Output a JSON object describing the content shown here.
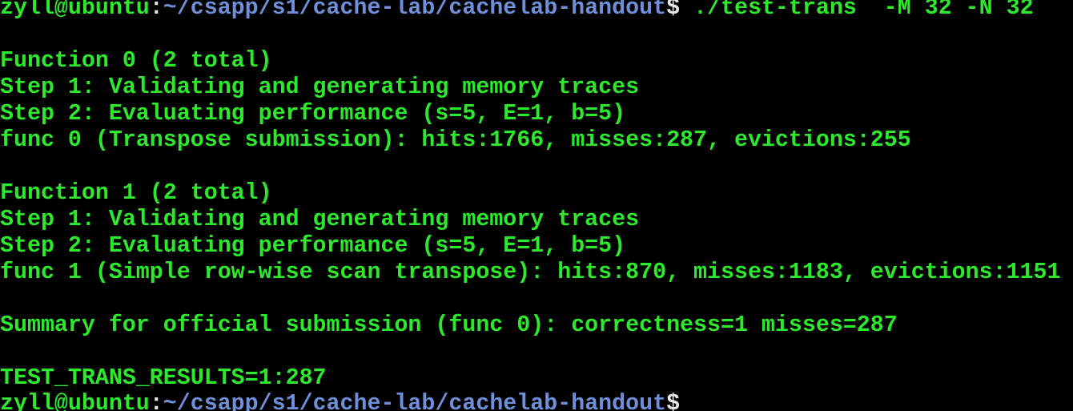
{
  "prompt": {
    "user_host": "zyll@ubuntu",
    "colon": ":",
    "path": "~/csapp/s1/cache-lab/cachelab-handout",
    "dollar": "$"
  },
  "command": " ./test-trans  -M 32 -N 32",
  "output": {
    "function0_header": "Function 0 (2 total)",
    "function0_step1": "Step 1: Validating and generating memory traces",
    "function0_step2": "Step 2: Evaluating performance (s=5, E=1, b=5)",
    "function0_result": "func 0 (Transpose submission): hits:1766, misses:287, evictions:255",
    "function1_header": "Function 1 (2 total)",
    "function1_step1": "Step 1: Validating and generating memory traces",
    "function1_step2": "Step 2: Evaluating performance (s=5, E=1, b=5)",
    "function1_result": "func 1 (Simple row-wise scan transpose): hits:870, misses:1183, evictions:1151",
    "summary": "Summary for official submission (func 0): correctness=1 misses=287",
    "test_results": "TEST_TRANS_RESULTS=1:287"
  },
  "colors": {
    "background": "#000000",
    "green_text": "#2ee82e",
    "path_blue": "#6f8fd8",
    "separator_white": "#e8e8e8"
  }
}
